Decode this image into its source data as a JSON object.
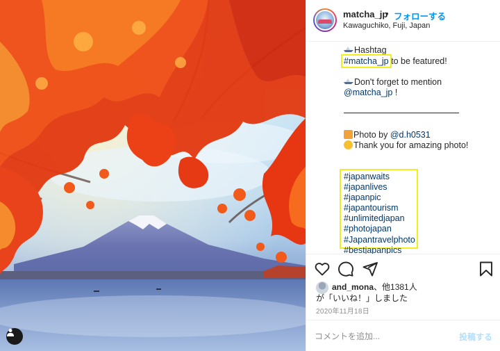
{
  "post": {
    "username": "matcha_jp",
    "separator": "•",
    "follow_label": "フォローする",
    "location": "Kawaguchiko, Fuji, Japan"
  },
  "caption": {
    "line1_text": "Hashtag",
    "featured_tag": "#matcha_jp",
    "featured_suffix": " to be featured!",
    "mention_prompt": "Don't forget to mention",
    "mention_handle": "@matcha_jp",
    "mention_suffix": " !",
    "photo_by_label": "Photo by ",
    "photo_by_handle": "@d.h0531",
    "thanks_text": "Thank you for amazing photo!",
    "hashtags": [
      "#japanwaits",
      "#japanlives",
      "#japanpic",
      "#japantourism",
      "#unlimitedjapan",
      "#photojapan",
      "#Japantravelphoto",
      "#bestjapanpics"
    ]
  },
  "likes": {
    "liker": "and_mona",
    "count_text": "、他1381人",
    "suffix_text": "が「いいね！」しました"
  },
  "date": "2020年11月18日",
  "comment": {
    "placeholder": "コメントを追加...",
    "post_label": "投稿する"
  },
  "icons": {
    "like": "heart-icon",
    "comment": "speech-bubble-icon",
    "share": "paper-plane-icon",
    "save": "bookmark-icon",
    "emoji": "smiley-icon",
    "user_tags": "person-icon"
  },
  "colors": {
    "link_blue": "#00376b",
    "follow_blue": "#0095f6",
    "highlight_yellow": "#f4ef1c",
    "post_disabled": "#b2dffc"
  }
}
